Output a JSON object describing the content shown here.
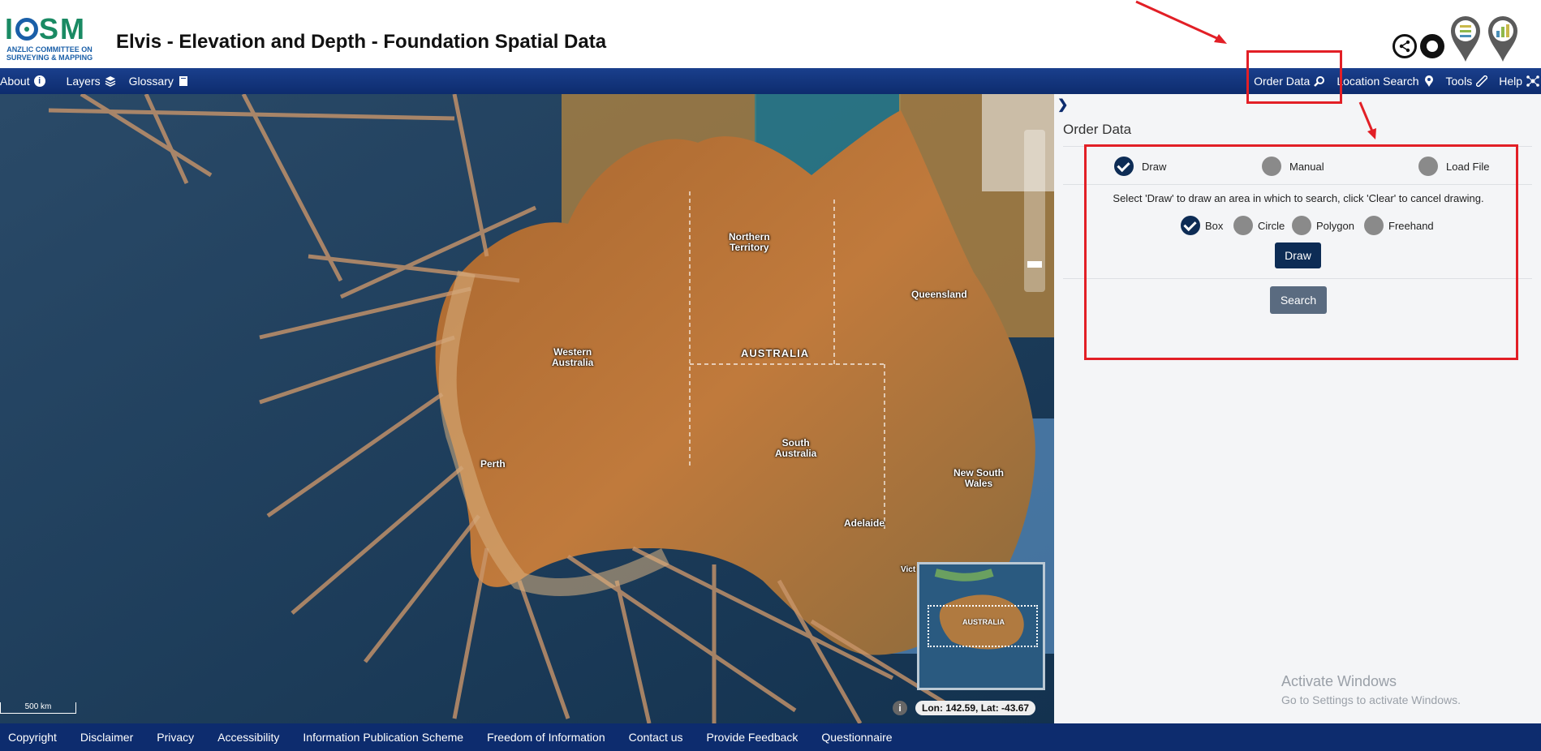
{
  "header": {
    "logo_text": "ICSM",
    "logo_subtitle_line1": "ANZLIC COMMITTEE ON",
    "logo_subtitle_line2": "SURVEYING & MAPPING",
    "title": "Elvis - Elevation and Depth - Foundation Spatial Data",
    "icons": [
      "share-icon",
      "aperture-icon",
      "map-pin-legend-icon",
      "map-pin-chart-icon"
    ]
  },
  "nav": {
    "left": [
      {
        "label": "About",
        "icon": "info-icon"
      },
      {
        "label": "Layers",
        "icon": "layers-icon"
      },
      {
        "label": "Glossary",
        "icon": "book-icon"
      }
    ],
    "right": [
      {
        "label": "Order Data",
        "icon": "search-icon"
      },
      {
        "label": "Location Search",
        "icon": "map-marker-icon"
      },
      {
        "label": "Tools",
        "icon": "ruler-icon"
      },
      {
        "label": "Help",
        "icon": "network-icon"
      }
    ]
  },
  "map": {
    "labels": {
      "northern_territory": "Northern\nTerritory",
      "queensland": "Queensland",
      "western_australia": "Western\nAustralia",
      "australia": "AUSTRALIA",
      "south_australia": "South\nAustralia",
      "new_south_wales": "New South\nWales",
      "perth": "Perth",
      "adelaide": "Adelaide",
      "vic": "Vict"
    },
    "overview_label": "AUSTRALIA",
    "coords": "Lon: 142.59, Lat: -43.67",
    "scale": "500 km",
    "info": "i"
  },
  "panel": {
    "collapse_icon": "chevron-right-icon",
    "title": "Order Data",
    "modes": [
      {
        "label": "Draw",
        "checked": true
      },
      {
        "label": "Manual",
        "checked": false
      },
      {
        "label": "Load File",
        "checked": false
      }
    ],
    "instruction": "Select 'Draw' to draw an area in which to search, click 'Clear' to cancel drawing.",
    "shapes": [
      {
        "label": "Box",
        "checked": true
      },
      {
        "label": "Circle",
        "checked": false
      },
      {
        "label": "Polygon",
        "checked": false
      },
      {
        "label": "Freehand",
        "checked": false
      }
    ],
    "draw_button": "Draw",
    "search_button": "Search"
  },
  "windows_watermark": {
    "line1": "Activate Windows",
    "line2": "Go to Settings to activate Windows."
  },
  "footer": {
    "links": [
      "Copyright",
      "Disclaimer",
      "Privacy",
      "Accessibility",
      "Information Publication Scheme",
      "Freedom of Information",
      "Contact us",
      "Provide Feedback",
      "Questionnaire"
    ]
  },
  "colors": {
    "nav_bg": "#1a3f8c",
    "footer_bg": "#0d2c6e",
    "annotation_red": "#e21f26",
    "draw_button": "#0d2c55",
    "search_button": "#5a6b80"
  }
}
